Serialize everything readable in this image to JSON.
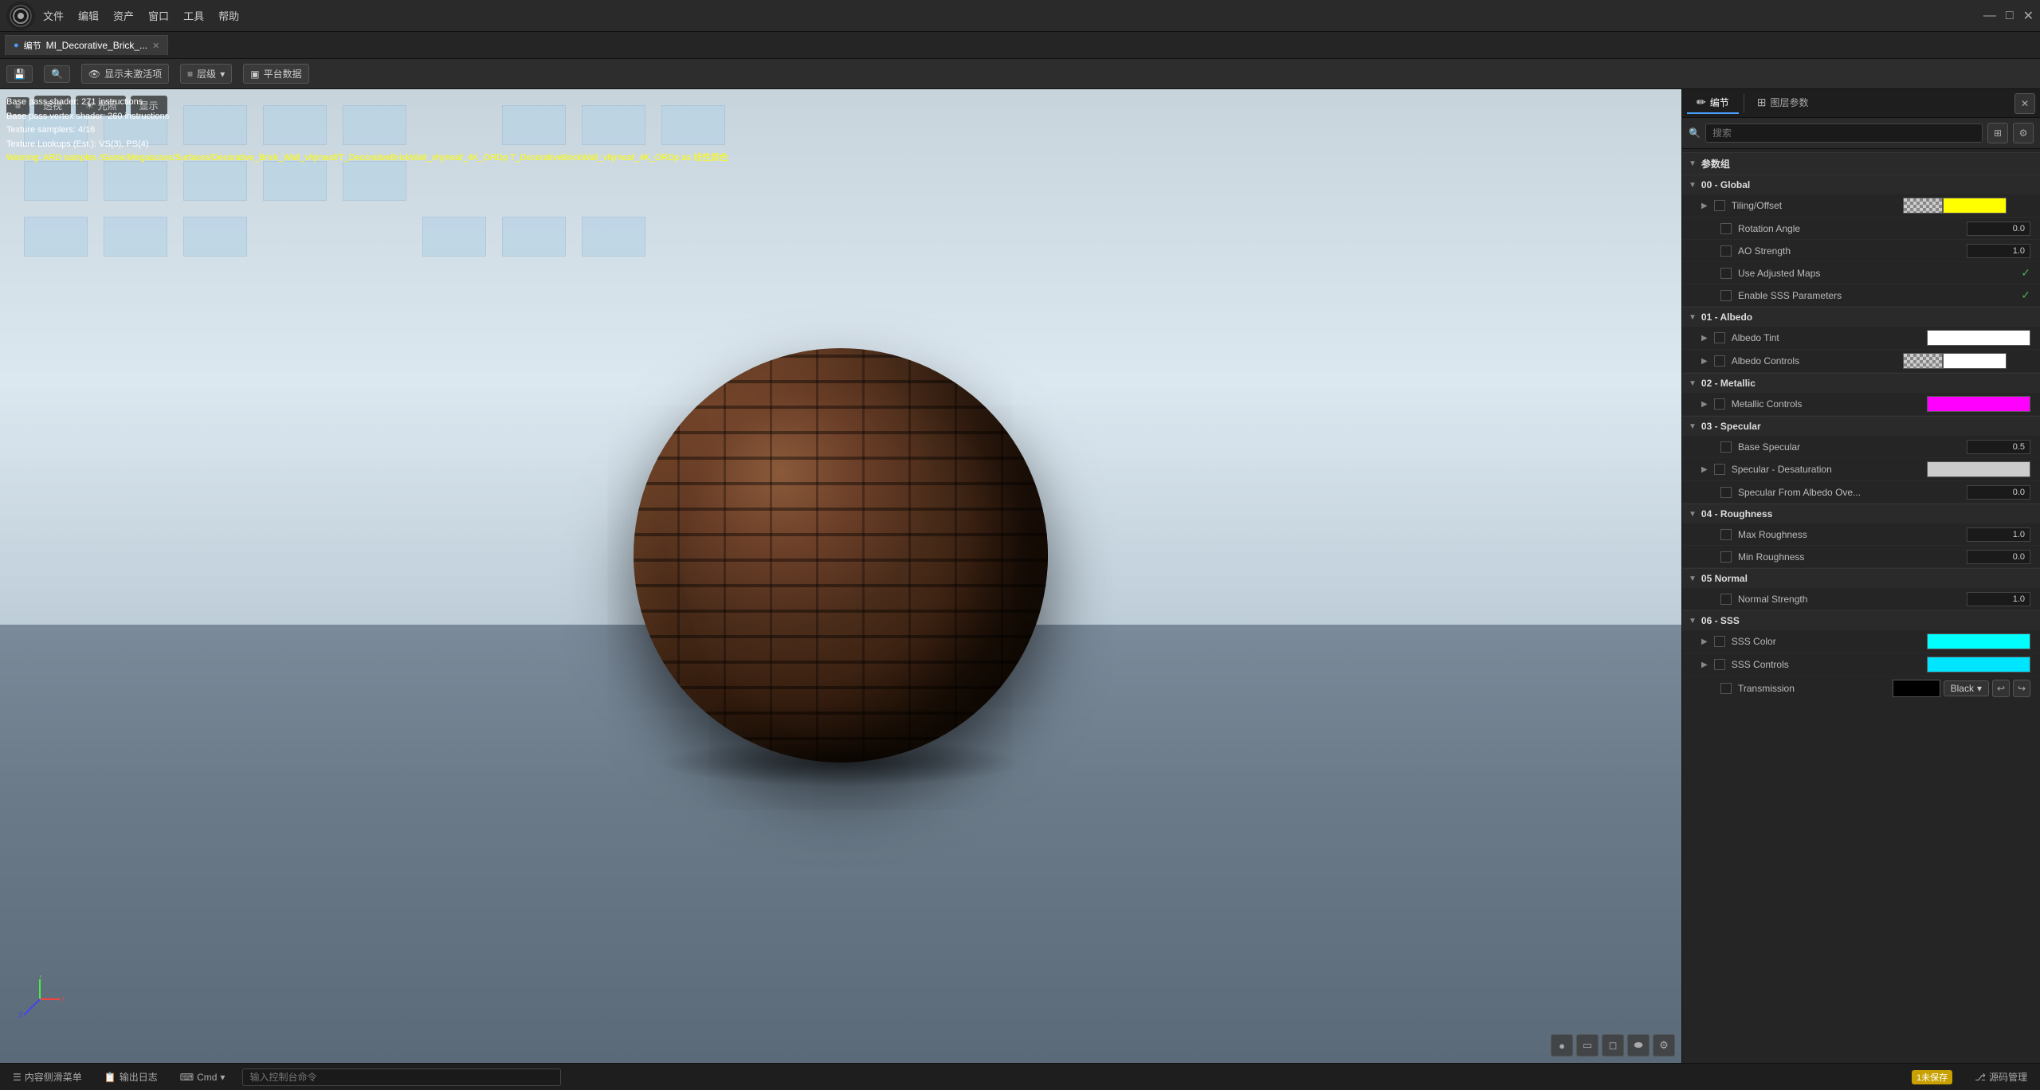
{
  "titlebar": {
    "logo": "◎",
    "menu": [
      "文件",
      "编辑",
      "资产",
      "窗口",
      "工具",
      "帮助"
    ],
    "tab_label": "MI_Decorative_Brick_...",
    "tab_modified": true,
    "window_controls": [
      "—",
      "□",
      "✕"
    ]
  },
  "toolbar": {
    "save_btn": "💾",
    "display_inactive_label": "显示未激活项",
    "layers_label": "层级",
    "platform_label": "平台数据"
  },
  "viewport": {
    "mode_label": "透视",
    "lighting_label": "光照",
    "display_label": "显示",
    "debug_lines": [
      "Base pass shader: 271 instructions",
      "Base pass vertex shader: 260 instructions",
      "Texture samplers: 4/16",
      "Texture Lookups (Est.): VS(3), PS(4)",
      "Warning: ARD samples /Game/Megascans/Surfaces/Decorative_Brick_Wall_vhjrneaf/T_DecorativeBrickWall_vhjrneaf_4K_ORDp T_DecorativeBrickWall_vhjrneaf_4K_ORDp as 线性颜色"
    ]
  },
  "right_panel": {
    "tab1_label": "编节",
    "tab2_label": "图层参数",
    "search_placeholder": "搜索",
    "param_group_label": "参数组",
    "groups": [
      {
        "id": "global",
        "label": "00 - Global",
        "params": [
          {
            "name": "Tiling/Offset",
            "type": "dual_swatch",
            "swatch1": "checkerboard",
            "swatch2": "yellow",
            "value": ""
          },
          {
            "name": "Rotation Angle",
            "type": "number",
            "value": "0.0"
          },
          {
            "name": "AO Strength",
            "type": "number",
            "value": "1.0"
          },
          {
            "name": "Use Adjusted Maps",
            "type": "checkbox_check",
            "value": "✓"
          },
          {
            "name": "Enable SSS Parameters",
            "type": "checkbox_check",
            "value": "✓"
          }
        ]
      },
      {
        "id": "albedo",
        "label": "01 - Albedo",
        "params": [
          {
            "name": "Albedo Tint",
            "type": "swatch",
            "swatch": "white",
            "value": ""
          },
          {
            "name": "Albedo Controls",
            "type": "dual_swatch",
            "swatch1": "checkerboard",
            "swatch2": "white",
            "value": ""
          }
        ]
      },
      {
        "id": "metallic",
        "label": "02 - Metallic",
        "params": [
          {
            "name": "Metallic Controls",
            "type": "swatch",
            "swatch": "magenta",
            "value": ""
          }
        ]
      },
      {
        "id": "specular",
        "label": "03 - Specular",
        "params": [
          {
            "name": "Base Specular",
            "type": "number",
            "value": "0.5"
          },
          {
            "name": "Specular - Desaturation",
            "type": "swatch",
            "swatch": "lightgray",
            "value": ""
          },
          {
            "name": "Specular From Albedo Ove...",
            "type": "number",
            "value": "0.0"
          }
        ]
      },
      {
        "id": "roughness",
        "label": "04 - Roughness",
        "params": [
          {
            "name": "Max Roughness",
            "type": "number",
            "value": "1.0"
          },
          {
            "name": "Min Roughness",
            "type": "number",
            "value": "0.0"
          }
        ]
      },
      {
        "id": "normal",
        "label": "05 Normal",
        "params": [
          {
            "name": "Normal Strength",
            "type": "number",
            "value": "1.0"
          }
        ]
      },
      {
        "id": "sss",
        "label": "06 - SSS",
        "params": [
          {
            "name": "SSS Color",
            "type": "swatch",
            "swatch": "cyan",
            "value": ""
          },
          {
            "name": "SSS Controls",
            "type": "swatch",
            "swatch": "cyan2",
            "value": ""
          },
          {
            "name": "Transmission",
            "type": "transmission",
            "swatch": "black",
            "dropdown": "Black"
          }
        ]
      }
    ]
  },
  "statusbar": {
    "content_btn": "内容侧滑菜单",
    "output_btn": "输出日志",
    "cmd_btn": "Cmd",
    "cmd_dropdown": "▾",
    "input_placeholder": "输入控制台命令",
    "unsaved_label": "1未保存",
    "source_control_label": "源码管理"
  }
}
